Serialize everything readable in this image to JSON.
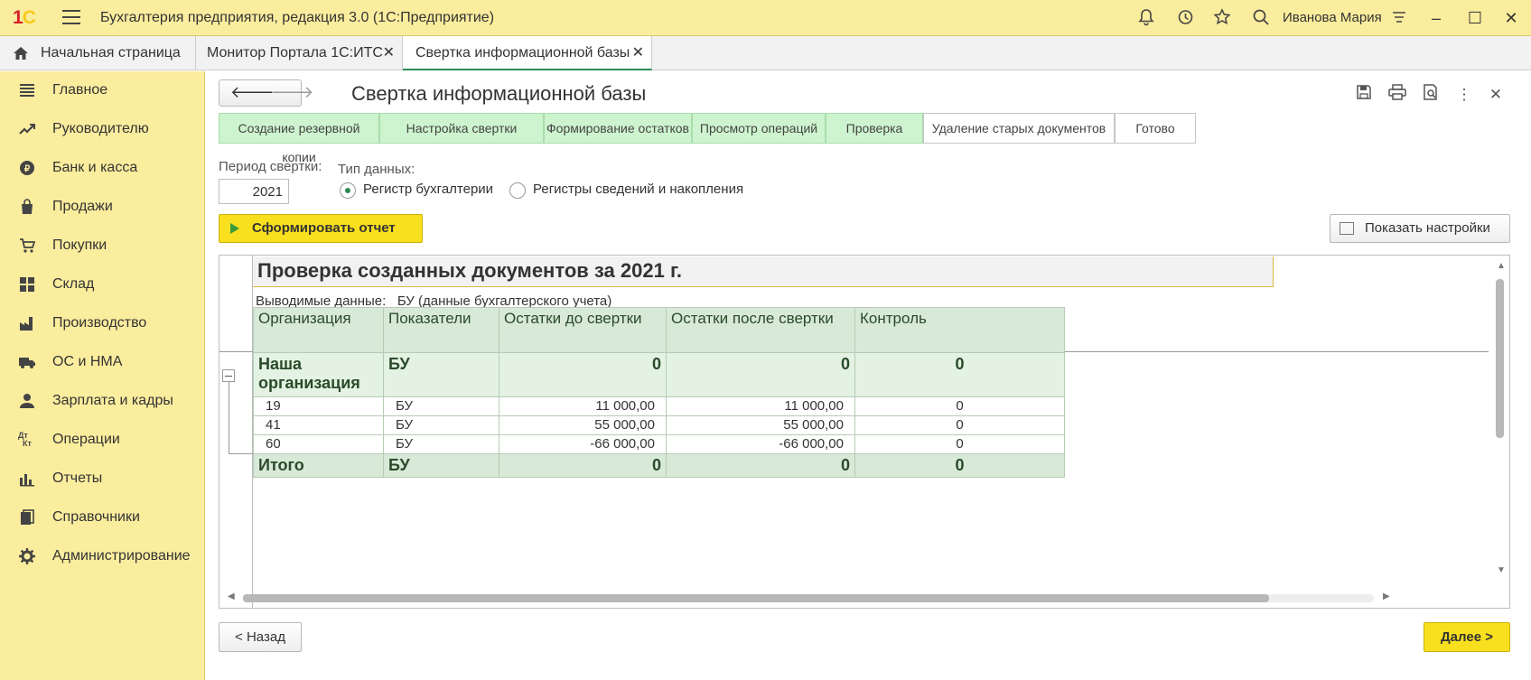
{
  "app": {
    "logo": "1С",
    "title": "Бухгалтерия предприятия, редакция 3.0  (1С:Предприятие)",
    "user": "Иванова Мария"
  },
  "tabs": [
    {
      "label": "Начальная страница"
    },
    {
      "label": "Монитор Портала 1С:ИТС"
    },
    {
      "label": "Свертка информационной базы"
    }
  ],
  "sidebar": {
    "items": [
      {
        "label": "Главное",
        "icon": "menu-lines-icon"
      },
      {
        "label": "Руководителю",
        "icon": "trend-icon"
      },
      {
        "label": "Банк и касса",
        "icon": "coin-icon"
      },
      {
        "label": "Продажи",
        "icon": "bag-icon"
      },
      {
        "label": "Покупки",
        "icon": "cart-icon"
      },
      {
        "label": "Склад",
        "icon": "grid-icon"
      },
      {
        "label": "Производство",
        "icon": "factory-icon"
      },
      {
        "label": "ОС и НМА",
        "icon": "truck-icon"
      },
      {
        "label": "Зарплата и кадры",
        "icon": "person-icon"
      },
      {
        "label": "Операции",
        "icon": "dt-kt-icon"
      },
      {
        "label": "Отчеты",
        "icon": "bar-chart-icon"
      },
      {
        "label": "Справочники",
        "icon": "books-icon"
      },
      {
        "label": "Администрирование",
        "icon": "gear-icon"
      }
    ]
  },
  "page": {
    "title": "Свертка информационной базы",
    "steps": [
      {
        "label": "Создание резервной копии",
        "state": "done"
      },
      {
        "label": "Настройка свертки",
        "state": "done"
      },
      {
        "label": "Формирование остатков",
        "state": "done"
      },
      {
        "label": "Просмотр операций",
        "state": "done"
      },
      {
        "label": "Проверка",
        "state": "done"
      },
      {
        "label": "Удаление старых документов",
        "state": "todo"
      },
      {
        "label": "Готово",
        "state": "todo"
      }
    ],
    "period_label": "Период свертки:",
    "period_value": "2021",
    "data_type_label": "Тип данных:",
    "radio_accounting": "Регистр бухгалтерии",
    "radio_registers": "Регистры сведений и накопления",
    "generate_btn": "Сформировать отчет",
    "settings_btn": "Показать настройки",
    "back_btn": "< Назад",
    "next_btn": "Далее >"
  },
  "report": {
    "title": "Проверка созданных документов за 2021 г.",
    "subtitle_label": "Выводимые данные:",
    "subtitle_value": "БУ (данные бухгалтерского учета)",
    "columns": [
      "Организация",
      "Показатели",
      "Остатки до свертки",
      "Остатки после свертки",
      "Контроль"
    ],
    "group": {
      "org": "Наша организация",
      "ind": "БУ",
      "before": "0",
      "after": "0",
      "control": "0"
    },
    "rows": [
      {
        "org": "19",
        "ind": "БУ",
        "before": "11 000,00",
        "after": "11 000,00",
        "control": "0"
      },
      {
        "org": "41",
        "ind": "БУ",
        "before": "55 000,00",
        "after": "55 000,00",
        "control": "0"
      },
      {
        "org": "60",
        "ind": "БУ",
        "before": "-66 000,00",
        "after": "-66 000,00",
        "control": "0"
      }
    ],
    "total": {
      "org": "Итого",
      "ind": "БУ",
      "before": "0",
      "after": "0",
      "control": "0"
    }
  }
}
